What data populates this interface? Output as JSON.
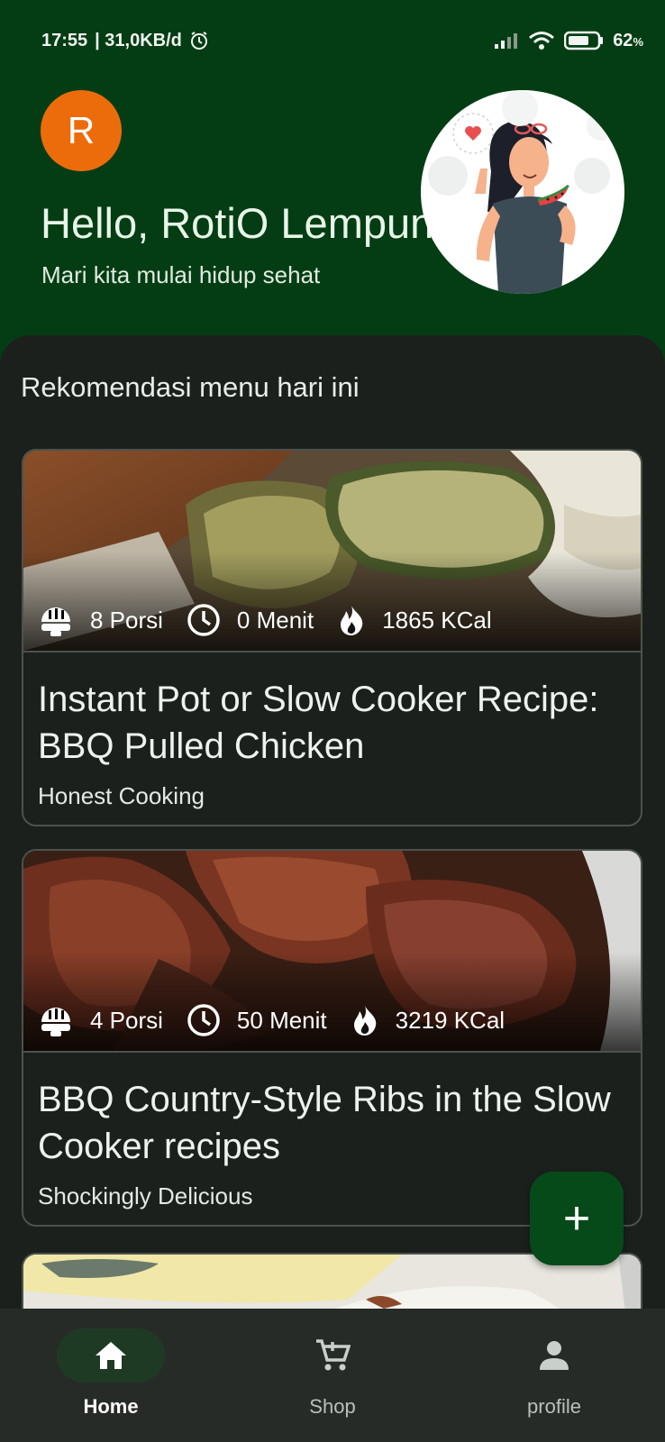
{
  "status_bar": {
    "time": "17:55",
    "network_speed": "| 31,0KB/d",
    "battery_percent": "62",
    "battery_unit": "%",
    "icons": [
      "alarm-icon",
      "signal-icon",
      "wifi-icon",
      "battery-icon"
    ]
  },
  "header": {
    "avatar_initial": "R",
    "greeting": "Hello, RotiO Lempung 1782",
    "subtitle": "Mari kita mulai hidup sehat",
    "illustration": "woman-eating-watermelon-illustration"
  },
  "section": {
    "title": "Rekomendasi menu hari ini"
  },
  "recipes": [
    {
      "portions": "8 Porsi",
      "time": "0 Menit",
      "calories": "1865 KCal",
      "title": "Instant Pot or Slow Cooker Recipe: BBQ Pulled Chicken",
      "source": "Honest Cooking"
    },
    {
      "portions": "4 Porsi",
      "time": "50 Menit",
      "calories": "3219 KCal",
      "title": "BBQ Country-Style Ribs in the Slow Cooker recipes",
      "source": "Shockingly Delicious"
    }
  ],
  "fab": {
    "label": "+"
  },
  "nav": {
    "items": [
      {
        "label": "Home",
        "icon": "home-icon",
        "active": true
      },
      {
        "label": "Shop",
        "icon": "cart-icon",
        "active": false
      },
      {
        "label": "profile",
        "icon": "person-icon",
        "active": false
      }
    ]
  },
  "colors": {
    "header_bg": "#043d14",
    "sheet_bg": "#1c201d",
    "avatar": "#ec6c0b",
    "fab": "#064a19",
    "nav_bg": "#272b28"
  }
}
